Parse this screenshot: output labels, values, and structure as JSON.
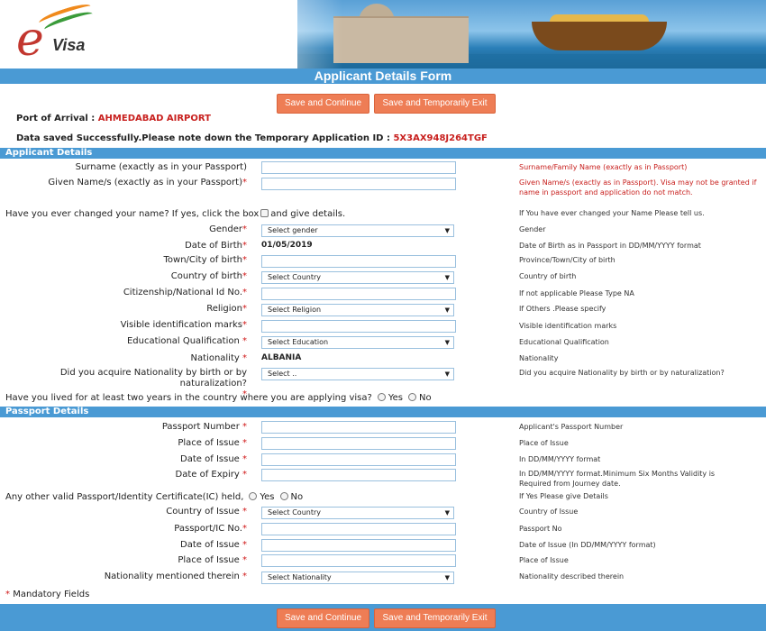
{
  "header": {
    "logo_text": "e",
    "logo_sub": "Visa",
    "title": "Applicant Details Form"
  },
  "actions": {
    "save_continue": "Save and Continue",
    "save_exit": "Save and Temporarily Exit"
  },
  "info": {
    "port_label": "Port of Arrival :",
    "port_value": "AHMEDABAD AIRPORT",
    "saved_msg": "Data saved Successfully.Please note down the Temporary Application ID :",
    "temp_id": "5X3AX948J264TGF"
  },
  "applicant": {
    "section": "Applicant Details",
    "surname_label": "Surname (exactly as in your Passport)",
    "surname_hint": "Surname/Family Name (exactly as in Passport)",
    "given_label_1": "Given Name/s (exactly as in your Passport)",
    "given_hint": "Given Name/s (exactly as in Passport). Visa may not be granted if name in passport and application do not match.",
    "changed_name_q": "Have you ever changed your name? If yes, click the box",
    "changed_name_q2": "and give details.",
    "changed_name_hint": "If You have ever changed your Name Please tell us.",
    "gender_label": "Gender",
    "gender_select": "Select gender",
    "gender_hint": "Gender",
    "dob_label": "Date of Birth",
    "dob_value": "01/05/2019",
    "dob_hint": "Date of Birth as in Passport in DD/MM/YYYY format",
    "town_label": "Town/City of birth",
    "town_hint": "Province/Town/City of birth",
    "country_label": "Country of birth",
    "country_select": "Select Country",
    "country_hint": "Country of birth",
    "citizen_label": "Citizenship/National Id No.",
    "citizen_hint": "If not applicable Please Type NA",
    "religion_label": "Religion",
    "religion_select": "Select Religion",
    "religion_hint": "If Others .Please specify",
    "marks_label": "Visible identification marks",
    "marks_hint": "Visible identification marks",
    "edu_label": "Educational Qualification",
    "edu_select": "Select Education",
    "edu_hint": "Educational Qualification",
    "nationality_label": "Nationality",
    "nationality_value": "ALBANIA",
    "nationality_hint": "Nationality",
    "acquire_label_1": "Did you acquire Nationality by birth or by",
    "acquire_label_2": "naturalization?",
    "acquire_select": "Select ..",
    "acquire_hint": "Did you acquire Nationality by birth or by naturalization?",
    "lived_q": "Have you lived for at least two years in the country where you are applying visa?",
    "yes": "Yes",
    "no": "No"
  },
  "passport": {
    "section": "Passport Details",
    "number_label": "Passport Number",
    "number_hint": "Applicant's Passport Number",
    "place_label": "Place of Issue",
    "place_hint": "Place of Issue",
    "doi_label": "Date of Issue",
    "doi_hint": "In DD/MM/YYYY format",
    "doe_label": "Date of Expiry",
    "doe_hint": "In DD/MM/YYYY format.Minimum Six Months Validity is Required from Journey date.",
    "other_q": "Any other valid Passport/Identity Certificate(IC) held,",
    "other_hint": "If Yes Please give Details",
    "ic_country_label": "Country of Issue",
    "ic_country_select": "Select Country",
    "ic_country_hint": "Country of Issue",
    "ic_no_label": "Passport/IC No.",
    "ic_no_hint": "Passport No",
    "ic_doi_label": "Date of Issue",
    "ic_doi_hint": "Date of Issue (In DD/MM/YYYY format)",
    "ic_place_label": "Place of Issue",
    "ic_place_hint": "Place of Issue",
    "ic_nat_label": "Nationality mentioned therein",
    "ic_nat_select": "Select Nationality",
    "ic_nat_hint": "Nationality described therein"
  },
  "mandatory": "Mandatory Fields",
  "star": "*",
  "arrow": "▼"
}
